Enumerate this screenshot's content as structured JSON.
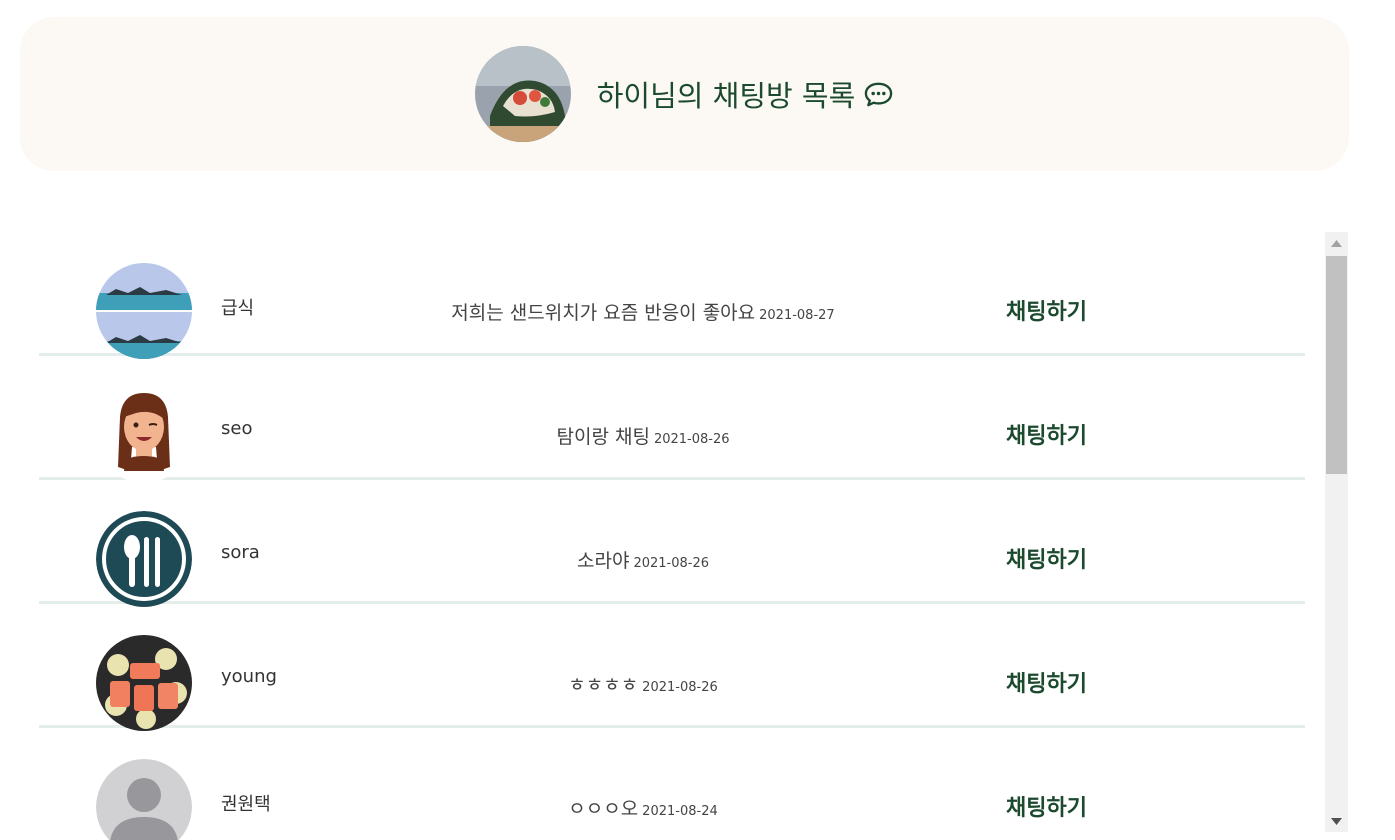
{
  "header": {
    "title": "하이님의 채팅방 목록",
    "avatar_icon": "profile-photo",
    "chat_icon": "chat-bubble-icon"
  },
  "colors": {
    "accent": "#1c4a2e",
    "header_bg": "#fcf9f4",
    "divider": "#e3eeec"
  },
  "rooms": [
    {
      "name": "급식",
      "message": "저희는 샌드위치가 요즘 반응이 좋아요",
      "date": "2021-08-27",
      "action": "채팅하기",
      "avatar": "ocean-photo"
    },
    {
      "name": "seo",
      "message": "탐이랑 채팅",
      "date": "2021-08-26",
      "action": "채팅하기",
      "avatar": "memoji-photo"
    },
    {
      "name": "sora",
      "message": "소라야",
      "date": "2021-08-26",
      "action": "채팅하기",
      "avatar": "utensils-logo"
    },
    {
      "name": "young",
      "message": "ㅎㅎㅎㅎ",
      "date": "2021-08-26",
      "action": "채팅하기",
      "avatar": "salmon-photo"
    },
    {
      "name": "권원택",
      "message": "ㅇㅇㅇ오",
      "date": "2021-08-24",
      "action": "채팅하기",
      "avatar": "default-person"
    }
  ]
}
